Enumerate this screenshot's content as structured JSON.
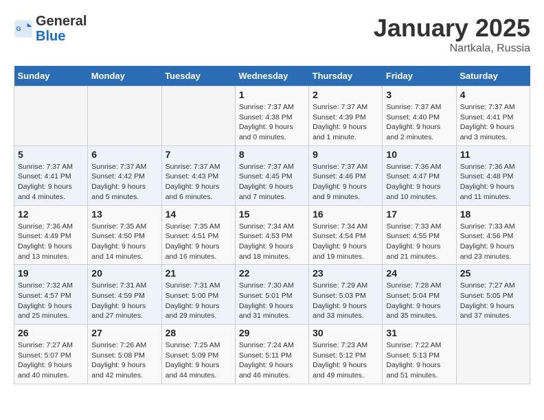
{
  "header": {
    "logo_general": "General",
    "logo_blue": "Blue",
    "month": "January 2025",
    "location": "Nartkala, Russia"
  },
  "weekdays": [
    "Sunday",
    "Monday",
    "Tuesday",
    "Wednesday",
    "Thursday",
    "Friday",
    "Saturday"
  ],
  "weeks": [
    [
      {
        "day": "",
        "info": ""
      },
      {
        "day": "",
        "info": ""
      },
      {
        "day": "",
        "info": ""
      },
      {
        "day": "1",
        "info": "Sunrise: 7:37 AM\nSunset: 4:38 PM\nDaylight: 9 hours\nand 0 minutes."
      },
      {
        "day": "2",
        "info": "Sunrise: 7:37 AM\nSunset: 4:39 PM\nDaylight: 9 hours\nand 1 minute."
      },
      {
        "day": "3",
        "info": "Sunrise: 7:37 AM\nSunset: 4:40 PM\nDaylight: 9 hours\nand 2 minutes."
      },
      {
        "day": "4",
        "info": "Sunrise: 7:37 AM\nSunset: 4:41 PM\nDaylight: 9 hours\nand 3 minutes."
      }
    ],
    [
      {
        "day": "5",
        "info": "Sunrise: 7:37 AM\nSunset: 4:41 PM\nDaylight: 9 hours\nand 4 minutes."
      },
      {
        "day": "6",
        "info": "Sunrise: 7:37 AM\nSunset: 4:42 PM\nDaylight: 9 hours\nand 5 minutes."
      },
      {
        "day": "7",
        "info": "Sunrise: 7:37 AM\nSunset: 4:43 PM\nDaylight: 9 hours\nand 6 minutes."
      },
      {
        "day": "8",
        "info": "Sunrise: 7:37 AM\nSunset: 4:45 PM\nDaylight: 9 hours\nand 7 minutes."
      },
      {
        "day": "9",
        "info": "Sunrise: 7:37 AM\nSunset: 4:46 PM\nDaylight: 9 hours\nand 9 minutes."
      },
      {
        "day": "10",
        "info": "Sunrise: 7:36 AM\nSunset: 4:47 PM\nDaylight: 9 hours\nand 10 minutes."
      },
      {
        "day": "11",
        "info": "Sunrise: 7:36 AM\nSunset: 4:48 PM\nDaylight: 9 hours\nand 11 minutes."
      }
    ],
    [
      {
        "day": "12",
        "info": "Sunrise: 7:36 AM\nSunset: 4:49 PM\nDaylight: 9 hours\nand 13 minutes."
      },
      {
        "day": "13",
        "info": "Sunrise: 7:35 AM\nSunset: 4:50 PM\nDaylight: 9 hours\nand 14 minutes."
      },
      {
        "day": "14",
        "info": "Sunrise: 7:35 AM\nSunset: 4:51 PM\nDaylight: 9 hours\nand 16 minutes."
      },
      {
        "day": "15",
        "info": "Sunrise: 7:34 AM\nSunset: 4:53 PM\nDaylight: 9 hours\nand 18 minutes."
      },
      {
        "day": "16",
        "info": "Sunrise: 7:34 AM\nSunset: 4:54 PM\nDaylight: 9 hours\nand 19 minutes."
      },
      {
        "day": "17",
        "info": "Sunrise: 7:33 AM\nSunset: 4:55 PM\nDaylight: 9 hours\nand 21 minutes."
      },
      {
        "day": "18",
        "info": "Sunrise: 7:33 AM\nSunset: 4:56 PM\nDaylight: 9 hours\nand 23 minutes."
      }
    ],
    [
      {
        "day": "19",
        "info": "Sunrise: 7:32 AM\nSunset: 4:57 PM\nDaylight: 9 hours\nand 25 minutes."
      },
      {
        "day": "20",
        "info": "Sunrise: 7:31 AM\nSunset: 4:59 PM\nDaylight: 9 hours\nand 27 minutes."
      },
      {
        "day": "21",
        "info": "Sunrise: 7:31 AM\nSunset: 5:00 PM\nDaylight: 9 hours\nand 29 minutes."
      },
      {
        "day": "22",
        "info": "Sunrise: 7:30 AM\nSunset: 5:01 PM\nDaylight: 9 hours\nand 31 minutes."
      },
      {
        "day": "23",
        "info": "Sunrise: 7:29 AM\nSunset: 5:03 PM\nDaylight: 9 hours\nand 33 minutes."
      },
      {
        "day": "24",
        "info": "Sunrise: 7:28 AM\nSunset: 5:04 PM\nDaylight: 9 hours\nand 35 minutes."
      },
      {
        "day": "25",
        "info": "Sunrise: 7:27 AM\nSunset: 5:05 PM\nDaylight: 9 hours\nand 37 minutes."
      }
    ],
    [
      {
        "day": "26",
        "info": "Sunrise: 7:27 AM\nSunset: 5:07 PM\nDaylight: 9 hours\nand 40 minutes."
      },
      {
        "day": "27",
        "info": "Sunrise: 7:26 AM\nSunset: 5:08 PM\nDaylight: 9 hours\nand 42 minutes."
      },
      {
        "day": "28",
        "info": "Sunrise: 7:25 AM\nSunset: 5:09 PM\nDaylight: 9 hours\nand 44 minutes."
      },
      {
        "day": "29",
        "info": "Sunrise: 7:24 AM\nSunset: 5:11 PM\nDaylight: 9 hours\nand 46 minutes."
      },
      {
        "day": "30",
        "info": "Sunrise: 7:23 AM\nSunset: 5:12 PM\nDaylight: 9 hours\nand 49 minutes."
      },
      {
        "day": "31",
        "info": "Sunrise: 7:22 AM\nSunset: 5:13 PM\nDaylight: 9 hours\nand 51 minutes."
      },
      {
        "day": "",
        "info": ""
      }
    ]
  ]
}
